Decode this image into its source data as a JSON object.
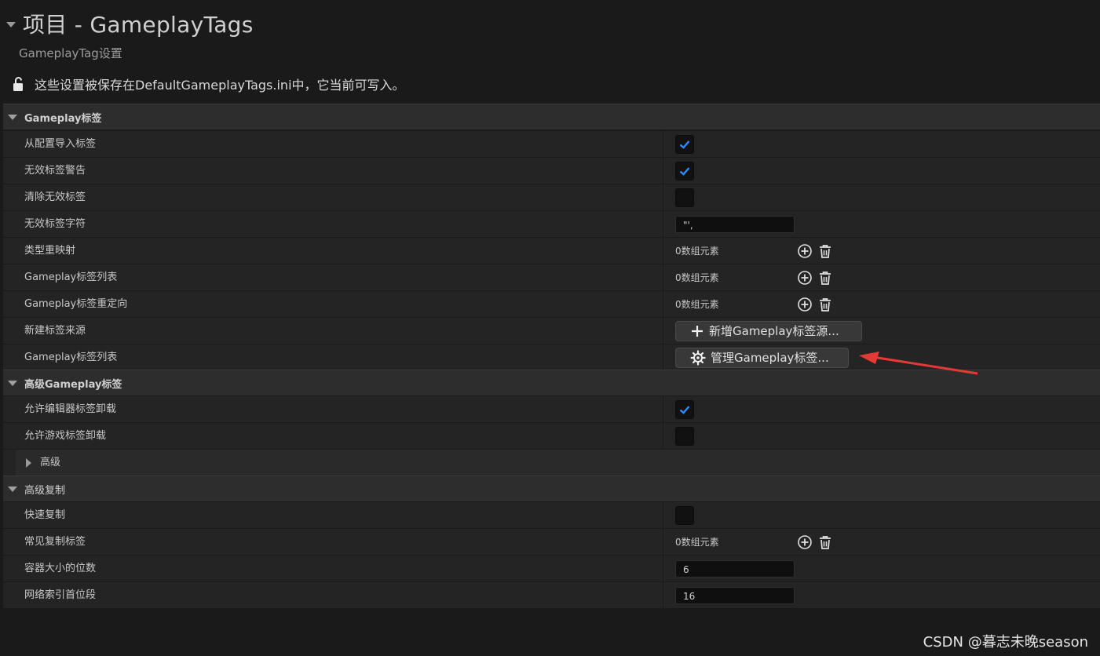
{
  "header": {
    "title": "项目 - GameplayTags",
    "subtitle": "GameplayTag设置",
    "notice": "这些设置被保存在DefaultGameplayTags.ini中，它当前可写入。"
  },
  "sections": [
    {
      "label": "Gameplay标签",
      "rows": [
        {
          "name": "从配置导入标签",
          "type": "checkbox",
          "checked": true
        },
        {
          "name": "无效标签警告",
          "type": "checkbox",
          "checked": true
        },
        {
          "name": "清除无效标签",
          "type": "checkbox",
          "checked": false
        },
        {
          "name": "无效标签字符",
          "type": "text",
          "value": "\"',"
        },
        {
          "name": "类型重映射",
          "type": "array",
          "count": "0数组元素"
        },
        {
          "name": "Gameplay标签列表",
          "type": "array",
          "count": "0数组元素"
        },
        {
          "name": "Gameplay标签重定向",
          "type": "array",
          "count": "0数组元素"
        },
        {
          "name": "新建标签来源",
          "type": "button",
          "label": "新增Gameplay标签源..."
        },
        {
          "name": "Gameplay标签列表",
          "type": "button",
          "label": "管理Gameplay标签..."
        }
      ]
    },
    {
      "label": "高级Gameplay标签",
      "rows": [
        {
          "name": "允许编辑器标签卸载",
          "type": "checkbox",
          "checked": true
        },
        {
          "name": "允许游戏标签卸载",
          "type": "checkbox",
          "checked": false
        }
      ],
      "subgroup": "高级"
    },
    {
      "label": "高级复制",
      "rows": [
        {
          "name": "快速复制",
          "type": "checkbox",
          "checked": false
        },
        {
          "name": "常见复制标签",
          "type": "array",
          "count": "0数组元素"
        },
        {
          "name": "容器大小的位数",
          "type": "text",
          "value": "6"
        },
        {
          "name": "网络索引首位段",
          "type": "text",
          "value": "16"
        }
      ]
    }
  ],
  "watermark": "CSDN @暮志未晚season",
  "colors": {
    "accent": "#2d8cff",
    "annotation_arrow": "#e53935"
  }
}
